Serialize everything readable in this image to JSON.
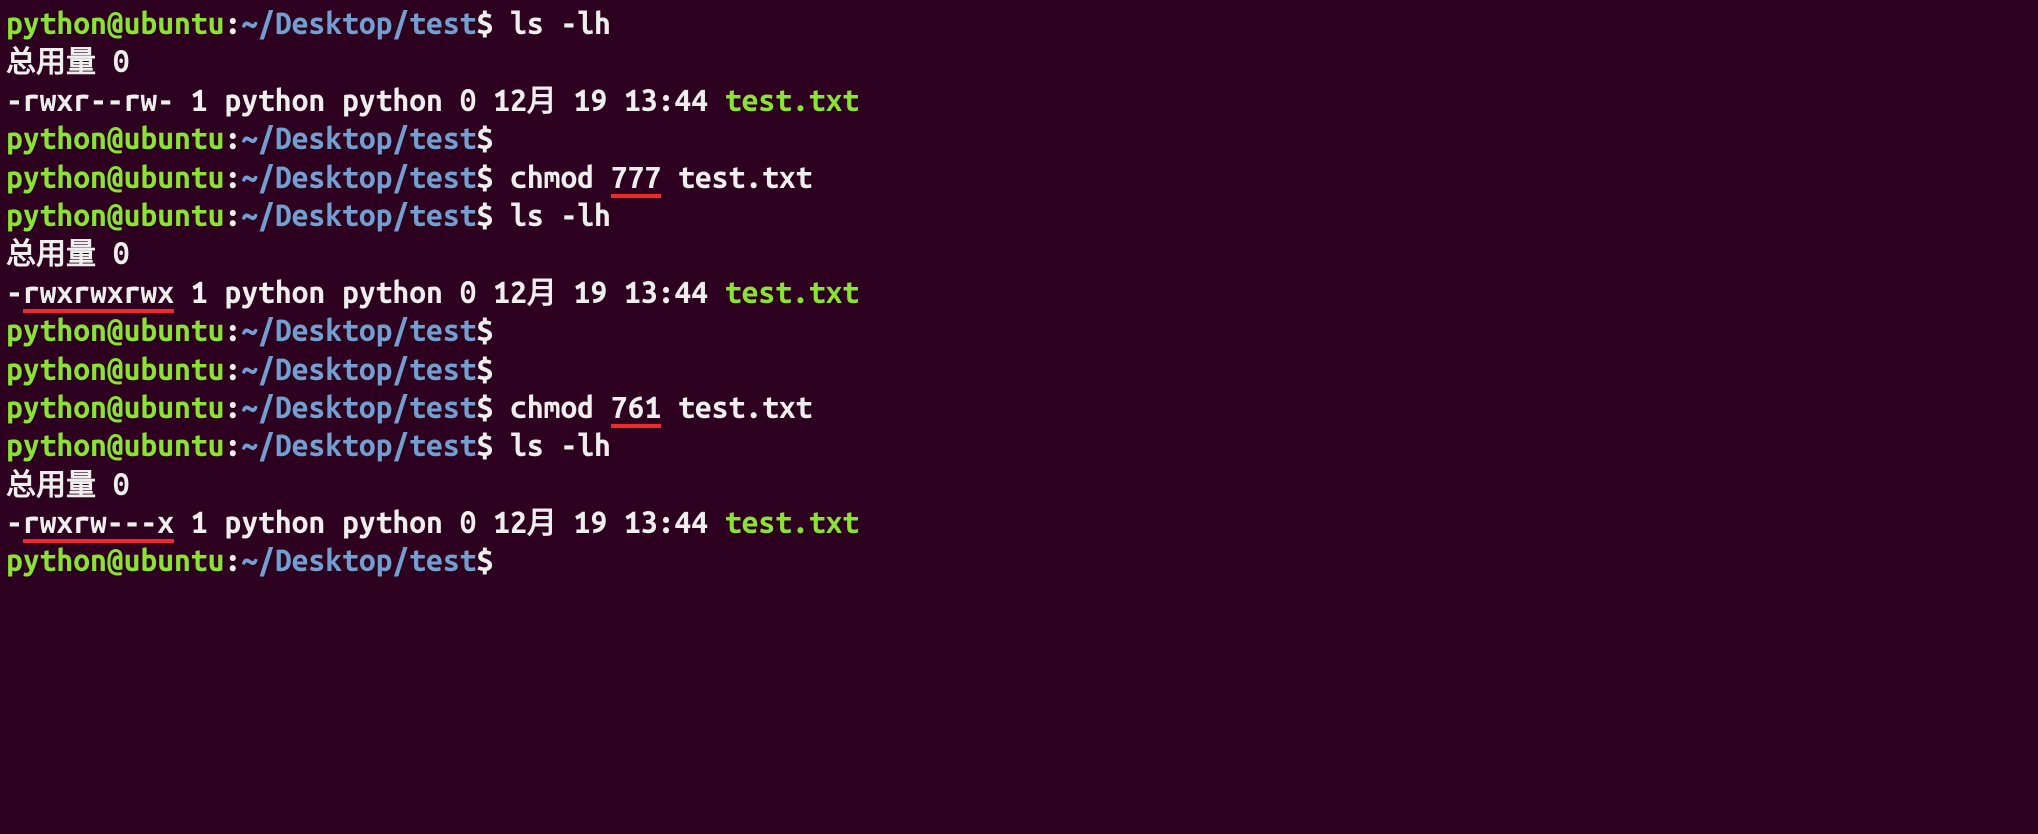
{
  "prompt": {
    "user": "python@ubuntu",
    "sep": ":",
    "path": "~/Desktop/test",
    "end": "$"
  },
  "lines": {
    "cmd1": "ls -lh",
    "total1": "总用量 0",
    "listing1": {
      "perms": "-rwxr--rw-",
      "meta": " 1 python python 0 12月 19 13:44 ",
      "file": "test.txt"
    },
    "cmd2": "chmod ",
    "cmd2_arg": "777",
    "cmd2_file": " test.txt",
    "cmd3": "ls -lh",
    "total2": "总用量 0",
    "listing2": {
      "dash": "-",
      "perms": "rwxrwxrwx",
      "meta": " 1 python python 0 12月 19 13:44 ",
      "file": "test.txt"
    },
    "cmd4": "chmod ",
    "cmd4_arg": "761",
    "cmd4_file": " test.txt",
    "cmd5": "ls -lh",
    "total3": "总用量 0",
    "listing3": {
      "dash": "-",
      "perms": "rwxrw---x",
      "meta": " 1 python python 0 12月 19 13:44 ",
      "file": "test.txt"
    }
  }
}
